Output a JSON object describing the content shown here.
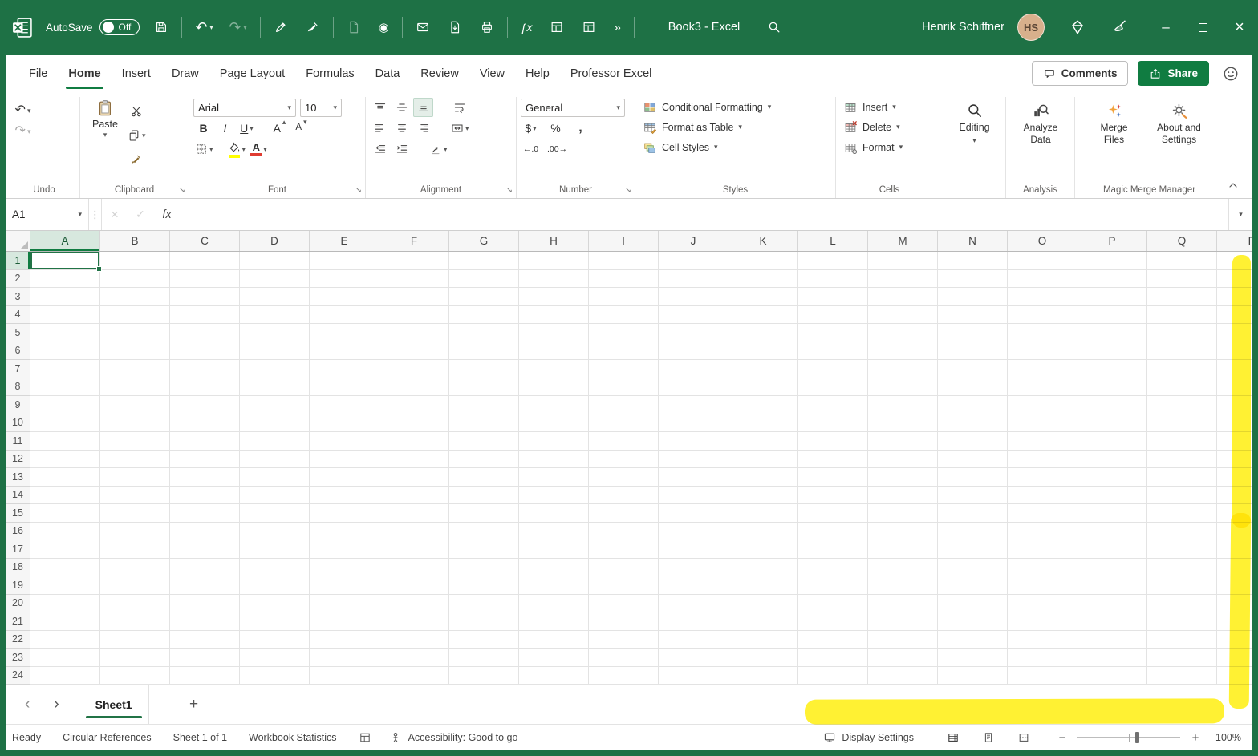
{
  "colors": {
    "title_bar_green": "#1E7145",
    "accent_green": "#107C41",
    "selection_green": "#217346",
    "highlight_yellow": "#FFEE00",
    "fill_color_swatch": "#FFFF00",
    "font_color_swatch": "#E03C31"
  },
  "glyphs": {
    "dropdown": "▾",
    "undo": "↶",
    "redo": "↷",
    "dots": "⋮",
    "cancel": "×",
    "check": "✓",
    "launcher": "↘",
    "overflow": "»",
    "nav_left": "‹",
    "nav_right": "›",
    "minimize": "–",
    "close": "×",
    "grow_font": "A",
    "shrink_font": "A",
    "grow_arrow": "▴",
    "shrink_arrow": "▾",
    "increase_decimal": "←.0",
    "decrease_decimal": ".00→",
    "record": "◉",
    "function": "ƒx"
  },
  "titlebar": {
    "autosave_label": "AutoSave",
    "autosave_state": "Off",
    "workbook_title": "Book3  -  Excel",
    "user_name": "Henrik Schiffner",
    "user_initials": "HS"
  },
  "ribbon_tabs": [
    {
      "label": "File",
      "active": false
    },
    {
      "label": "Home",
      "active": true
    },
    {
      "label": "Insert",
      "active": false
    },
    {
      "label": "Draw",
      "active": false
    },
    {
      "label": "Page Layout",
      "active": false
    },
    {
      "label": "Formulas",
      "active": false
    },
    {
      "label": "Data",
      "active": false
    },
    {
      "label": "Review",
      "active": false
    },
    {
      "label": "View",
      "active": false
    },
    {
      "label": "Help",
      "active": false
    },
    {
      "label": "Professor Excel",
      "active": false
    }
  ],
  "tab_actions": {
    "comments": "Comments",
    "share": "Share"
  },
  "ribbon": {
    "undo_group": "Undo",
    "clipboard": {
      "paste": "Paste",
      "label": "Clipboard"
    },
    "font": {
      "name": "Arial",
      "size": "10",
      "bold": "B",
      "italic": "I",
      "underline": "U",
      "label": "Font"
    },
    "alignment": {
      "label": "Alignment"
    },
    "number": {
      "format": "General",
      "currency": "$",
      "percent": "%",
      "comma": ",",
      "label": "Number"
    },
    "styles": {
      "conditional_formatting": "Conditional Formatting",
      "format_as_table": "Format as Table",
      "cell_styles": "Cell Styles",
      "label": "Styles"
    },
    "cells": {
      "insert": "Insert",
      "delete": "Delete",
      "format": "Format",
      "label": "Cells"
    },
    "editing": {
      "label": "Editing"
    },
    "analysis": {
      "analyze_data": "Analyze Data",
      "label": "Analysis"
    },
    "magic_merge": {
      "merge_files": "Merge Files",
      "about_settings": "About and Settings",
      "label": "Magic Merge Manager"
    }
  },
  "formula_bar": {
    "name_box": "A1",
    "fx": "fx",
    "formula": ""
  },
  "grid": {
    "columns": [
      "A",
      "B",
      "C",
      "D",
      "E",
      "F",
      "G",
      "H",
      "I",
      "J",
      "K",
      "L",
      "M",
      "N",
      "O",
      "P",
      "Q",
      "R"
    ],
    "row_count": 24,
    "selected_cell": "A1",
    "selected_column": "A",
    "selected_row": 1
  },
  "sheet_bar": {
    "tabs": [
      {
        "label": "Sheet1",
        "active": true
      }
    ],
    "add_sheet": "+"
  },
  "status_bar": {
    "items_left": [
      "Ready",
      "Circular References",
      "Sheet 1 of 1",
      "Workbook Statistics"
    ],
    "accessibility": "Accessibility: Good to go",
    "display_settings": "Display Settings",
    "zoom_level": "100%",
    "zoom_minus": "−",
    "zoom_plus": "+"
  }
}
